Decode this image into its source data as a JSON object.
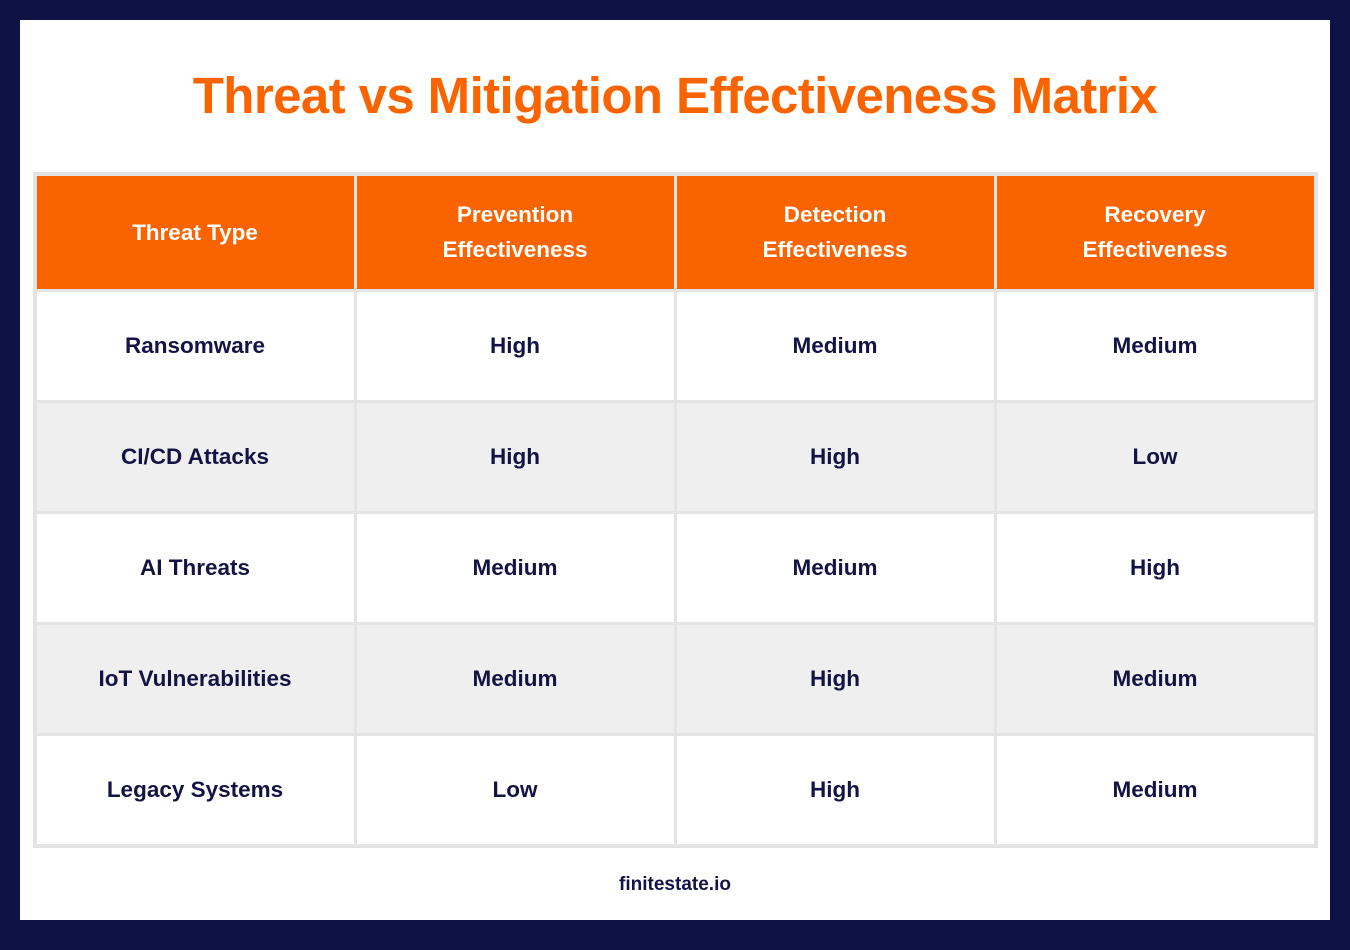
{
  "theme": {
    "frame_color": "#0f1244",
    "accent_orange": "#f96400",
    "text_navy": "#131444",
    "row_alt": "#efefef",
    "grid_line": "#e4e4e7"
  },
  "header": {
    "title": "Threat vs Mitigation Effectiveness Matrix"
  },
  "table": {
    "columns": [
      {
        "line1": "Threat Type",
        "line2": ""
      },
      {
        "line1": "Prevention",
        "line2": "Effectiveness"
      },
      {
        "line1": "Detection",
        "line2": "Effectiveness"
      },
      {
        "line1": "Recovery",
        "line2": "Effectiveness"
      }
    ],
    "rows": [
      {
        "threat": "Ransomware",
        "prevention": "High",
        "detection": "Medium",
        "recovery": "Medium"
      },
      {
        "threat": "CI/CD Attacks",
        "prevention": "High",
        "detection": "High",
        "recovery": "Low"
      },
      {
        "threat": "AI Threats",
        "prevention": "Medium",
        "detection": "Medium",
        "recovery": "High"
      },
      {
        "threat": "IoT Vulnerabilities",
        "prevention": "Medium",
        "detection": "High",
        "recovery": "Medium"
      },
      {
        "threat": "Legacy Systems",
        "prevention": "Low",
        "detection": "High",
        "recovery": "Medium"
      }
    ]
  },
  "footer": {
    "brand": "finitestate.io"
  },
  "chart_data": {
    "type": "table",
    "title": "Threat vs Mitigation Effectiveness Matrix",
    "columns": [
      "Threat Type",
      "Prevention Effectiveness",
      "Detection Effectiveness",
      "Recovery Effectiveness"
    ],
    "rows": [
      [
        "Ransomware",
        "High",
        "Medium",
        "Medium"
      ],
      [
        "CI/CD Attacks",
        "High",
        "High",
        "Low"
      ],
      [
        "AI Threats",
        "Medium",
        "Medium",
        "High"
      ],
      [
        "IoT Vulnerabilities",
        "Medium",
        "High",
        "Medium"
      ],
      [
        "Legacy Systems",
        "Low",
        "High",
        "Medium"
      ]
    ]
  }
}
